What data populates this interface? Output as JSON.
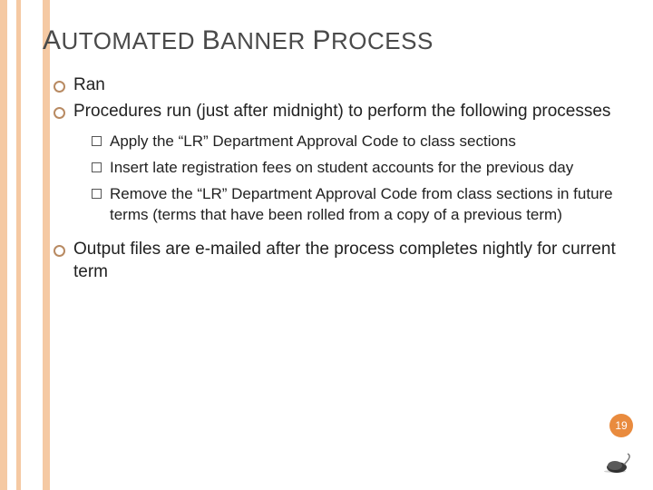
{
  "title_parts": {
    "w1a": "A",
    "w1b": "UTOMATED",
    "w2a": "B",
    "w2b": "ANNER",
    "w3a": "P",
    "w3b": "ROCESS"
  },
  "bullets": {
    "b1": "Ran",
    "b2": "Procedures run (just after midnight) to perform the following processes",
    "b3": "Output files are e-mailed after the process completes nightly for current term"
  },
  "sub": {
    "s1": "Apply the “LR” Department Approval Code to class sections",
    "s2": "Insert late registration fees on student accounts for the previous day",
    "s3": "Remove the “LR” Department Approval Code from class sections in future terms (terms that have been rolled from a copy of a previous term)"
  },
  "page_number": "19",
  "colors": {
    "accent": "#e98b3e",
    "stripe": "#f5c9a3",
    "bullet_ring": "#b88a62"
  }
}
